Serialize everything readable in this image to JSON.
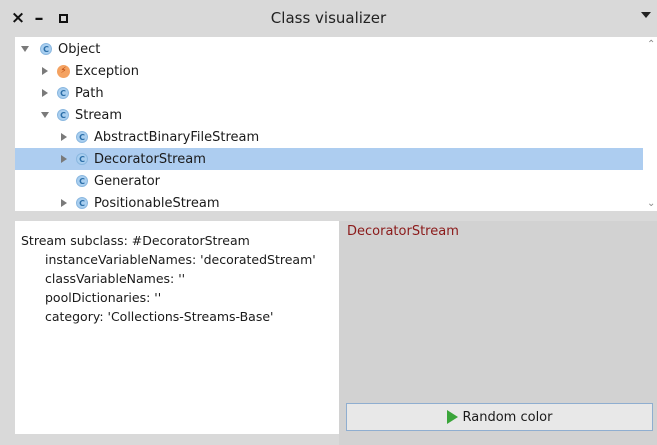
{
  "window": {
    "title": "Class visualizer",
    "close_icon": "close-icon",
    "minimize_icon": "minimize-icon",
    "maximize_icon": "maximize-icon"
  },
  "tree": {
    "nodes": [
      {
        "label": "Object",
        "icon": "class-icon",
        "icon_glyph": "C",
        "expanded": true,
        "depth": 0
      },
      {
        "label": "Exception",
        "icon": "exception-icon",
        "icon_glyph": "⚡",
        "expanded": false,
        "depth": 1
      },
      {
        "label": "Path",
        "icon": "class-icon",
        "icon_glyph": "C",
        "expanded": false,
        "depth": 1
      },
      {
        "label": "Stream",
        "icon": "class-icon",
        "icon_glyph": "C",
        "expanded": true,
        "depth": 1
      },
      {
        "label": "AbstractBinaryFileStream",
        "icon": "class-icon",
        "icon_glyph": "C",
        "expanded": false,
        "depth": 2
      },
      {
        "label": "DecoratorStream",
        "icon": "class-icon",
        "icon_glyph": "C",
        "expanded": false,
        "depth": 2,
        "selected": true
      },
      {
        "label": "Generator",
        "icon": "class-icon",
        "icon_glyph": "C",
        "leaf": true,
        "depth": 2
      },
      {
        "label": "PositionableStream",
        "icon": "class-icon",
        "icon_glyph": "C",
        "expanded": false,
        "depth": 2
      }
    ]
  },
  "definition": {
    "line1": "Stream subclass: #DecoratorStream",
    "line2": "instanceVariableNames: 'decoratedStream'",
    "line3": "classVariableNames: ''",
    "line4": "poolDictionaries: ''",
    "line5": "category: 'Collections-Streams-Base'"
  },
  "visualizer": {
    "class_name": "DecoratorStream",
    "random_color_label": "Random color",
    "button_icon": "play-icon",
    "class_name_color": "#8b1a1a",
    "play_color": "#3aa53a",
    "selection_color": "#adcdf0"
  }
}
